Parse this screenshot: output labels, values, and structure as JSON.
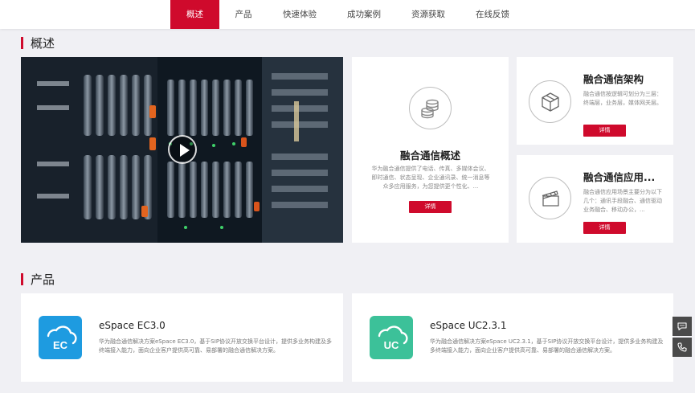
{
  "nav": {
    "tabs": [
      {
        "label": "概述",
        "active": true
      },
      {
        "label": "产品",
        "active": false
      },
      {
        "label": "快速体验",
        "active": false
      },
      {
        "label": "成功案例",
        "active": false
      },
      {
        "label": "资源获取",
        "active": false
      },
      {
        "label": "在线反馈",
        "active": false
      }
    ]
  },
  "overview": {
    "title": "概述",
    "card_main": {
      "title": "融合通信概述",
      "desc": "华为融合通信提供了电话、传真、多媒体会议、即时通信、状态呈现、企业通讯录、统一消息等众多应用服务，为您提供更个性化、...",
      "button": "详情",
      "icon": "coins-stack-icon"
    },
    "card_arch": {
      "title": "融合通信架构",
      "desc": "融合通信按逻辑可划分为三层：终端层，业务层，媒体网关层。",
      "button": "详情",
      "icon": "cube-icon"
    },
    "card_app": {
      "title": "融合通信应用...",
      "desc": "融合通信应用场景主要分为以下几个：通讯手段融合、通信驱动业务融合、移动办公，...",
      "button": "详情",
      "icon": "clapperboard-icon"
    }
  },
  "products": {
    "title": "产品",
    "items": [
      {
        "name": "eSpace EC3.0",
        "logo_text": "EC",
        "logo_color": "#1e9be0",
        "desc": "华为融合通信解决方案eSpace EC3.0，基于SIP协议开放交换平台设计，提供多业务构建及多终端接入能力，面向企业客户提供高可靠、易部署的融合通信解决方案。"
      },
      {
        "name": "eSpace UC2.3.1",
        "logo_text": "UC",
        "logo_color": "#3cc199",
        "desc": "华为融合通信解决方案eSpace UC2.3.1，基于SIP协议开放交换平台设计，提供多业务构建及多终端接入能力，面向企业客户提供高可靠、易部署的融合通信解决方案。"
      }
    ]
  },
  "floating": [
    "chat-bubble-icon",
    "phone-icon"
  ],
  "colors": {
    "accent": "#cf0a2c",
    "page_bg": "#f0f0f4"
  }
}
